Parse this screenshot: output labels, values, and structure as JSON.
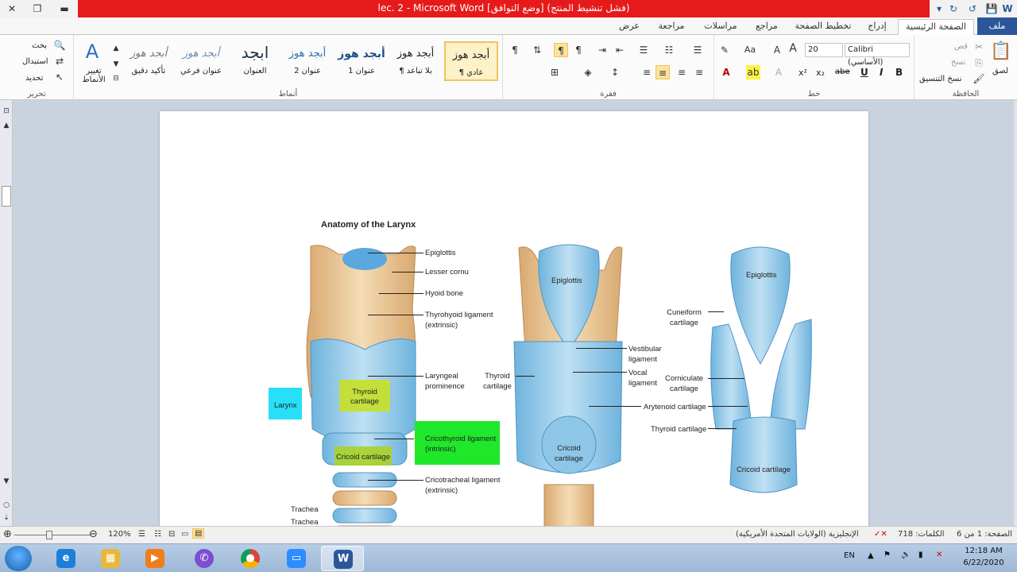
{
  "window": {
    "title": "lec. 2  -  Microsoft Word  [وضع التوافق] (فشل تنشيط المنتج)",
    "accent": "#e61a1a"
  },
  "tabs": [
    {
      "label": "ملف"
    },
    {
      "label": "الصفحة الرئيسية"
    },
    {
      "label": "إدراج"
    },
    {
      "label": "تخطيط الصفحة"
    },
    {
      "label": "مراجع"
    },
    {
      "label": "مراسلات"
    },
    {
      "label": "مراجعة"
    },
    {
      "label": "عرض"
    }
  ],
  "ribbon": {
    "clipboard": {
      "label": "الحافظة",
      "paste": "لصق",
      "cut": "قص",
      "copy": "نسخ",
      "format_painter": "نسخ التنسيق"
    },
    "font": {
      "label": "خط",
      "font_name": "Calibri (الأساسي)",
      "font_size": "20",
      "bold": "B",
      "italic": "I",
      "underline": "U",
      "strike": "abe",
      "subscript": "x₂",
      "superscript": "x²"
    },
    "paragraph": {
      "label": "فقرة"
    },
    "styles": {
      "label": "أنماط",
      "items": [
        {
          "sample": "أبجد هوز",
          "name": "¶ عادي"
        },
        {
          "sample": "أبجد هوز",
          "name": "¶ بلا تباعد"
        },
        {
          "sample": "أبجد هوز",
          "name": "عنوان 1"
        },
        {
          "sample": "أبجد هوز",
          "name": "عنوان 2"
        },
        {
          "sample": "ابجد",
          "name": "العنوان"
        },
        {
          "sample": "أبجد هوز",
          "name": "عنوان فرعي"
        },
        {
          "sample": "أبجد هوز",
          "name": "تأكيد دقيق"
        }
      ],
      "change_styles": "تغيير الأنماط"
    },
    "editing": {
      "label": "تحرير",
      "find": "بحث",
      "replace": "استبدال",
      "select": "تحديد"
    }
  },
  "document": {
    "figure": {
      "title": "Anatomy of the Larynx",
      "labels": {
        "epiglottis_1": "Epiglottis",
        "lesser_cornu": "Lesser cornu",
        "hyoid_bone": "Hyoid bone",
        "thyrohyoid_1": "Thyrohyoid ligament",
        "thyrohyoid_2": "(extrinsic)",
        "laryngeal_1": "Laryngeal",
        "laryngeal_2": "prominence",
        "thyroid_cart_box_1": "Thyroid",
        "thyroid_cart_box_2": "cartilage",
        "larynx": "Larynx",
        "cricothyroid_1": "Cricothyroid ligament",
        "cricothyroid_2": "(intrinsic)",
        "cricoid_box": "Cricoid cartilage",
        "cricotracheal_1": "Cricotracheal ligament",
        "cricotracheal_2": "(extrinsic)",
        "trachea_1": "Trachea",
        "trachea_2": "Trachea",
        "epiglottis_2": "Epiglottis",
        "vestibular_1": "Vestibular",
        "vestibular_2": "ligament",
        "vocal_1": "Vocal",
        "vocal_2": "ligament",
        "thyroid_mid_1": "Thyroid",
        "thyroid_mid_2": "cartilage",
        "cricoid_mid_1": "Cricoid",
        "cricoid_mid_2": "cartilage",
        "epiglottis_3": "Epiglottis",
        "cuneiform_1": "Cuneiform",
        "cuneiform_2": "cartilage",
        "corniculate_1": "Corniculate",
        "corniculate_2": "cartilage",
        "arytenoid": "Arytenoid cartilage",
        "thyroid_right": "Thyroid cartilage",
        "cricoid_right": "Cricoid cartilage"
      }
    }
  },
  "status": {
    "page": "الصفحة: 1 من 6",
    "words": "الكلمات: 718",
    "language": "الإنجليزية (الولايات المتحدة الأمريكية)",
    "zoom": "120%"
  },
  "taskbar": {
    "lang": "EN",
    "time": "12:18 AM",
    "date": "6/22/2020",
    "apps": [
      {
        "name": "ie",
        "color": "#1e7fd8"
      },
      {
        "name": "explorer",
        "color": "#e7b93a"
      },
      {
        "name": "media",
        "color": "#f07d1a"
      },
      {
        "name": "viber",
        "color": "#7a4fd0"
      },
      {
        "name": "chrome",
        "color": "#3b9c3b"
      },
      {
        "name": "zoom",
        "color": "#2d8cff"
      },
      {
        "name": "word",
        "color": "#2b579a",
        "glyph": "W"
      }
    ]
  }
}
